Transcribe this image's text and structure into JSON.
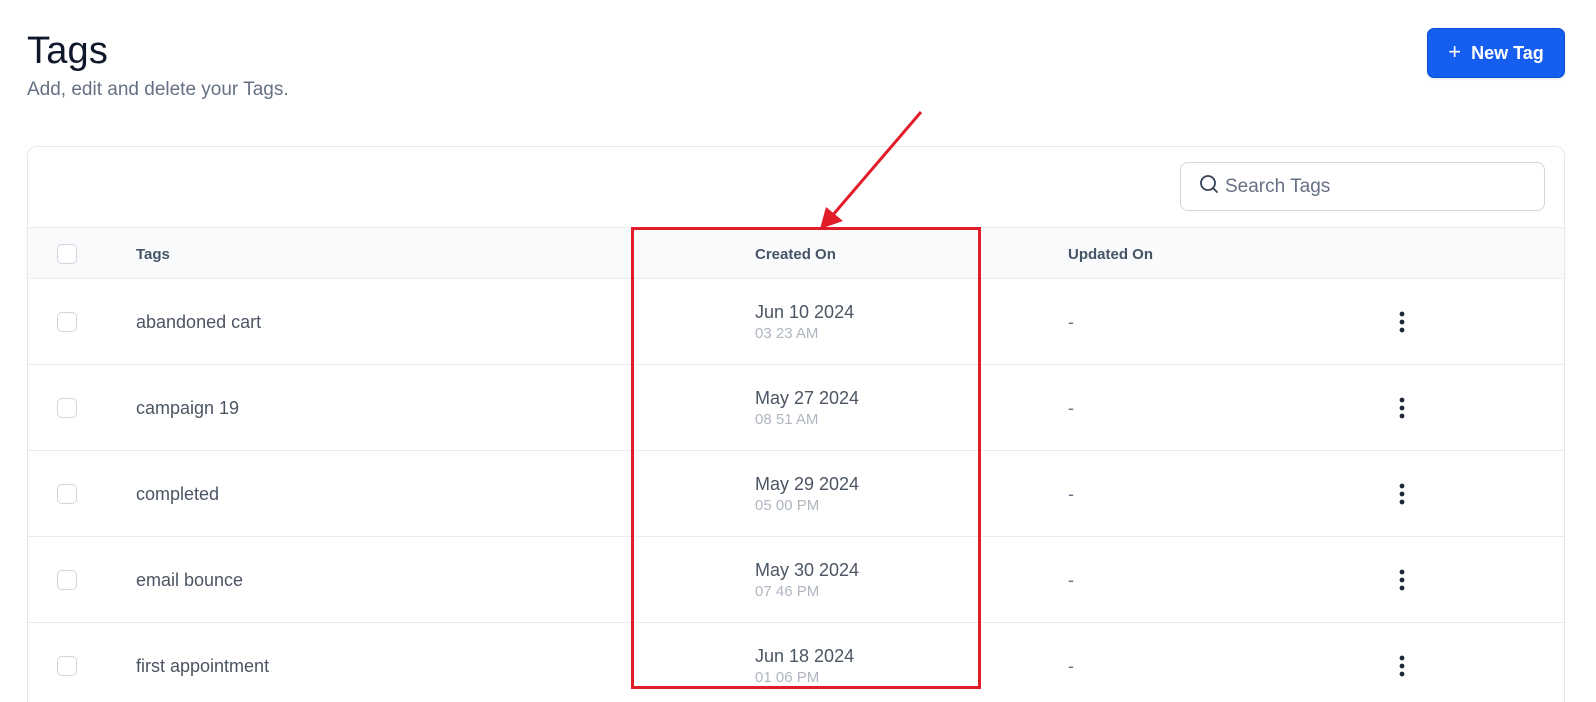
{
  "header": {
    "title": "Tags",
    "subtitle": "Add, edit and delete your Tags."
  },
  "new_tag_button": {
    "icon": "+",
    "label": "New Tag"
  },
  "search": {
    "placeholder": "Search Tags",
    "value": ""
  },
  "table": {
    "columns": {
      "tags": "Tags",
      "created_on": "Created On",
      "updated_on": "Updated On"
    },
    "rows": [
      {
        "name": "abandoned cart",
        "created_date": "Jun 10 2024",
        "created_time": "03 23 AM",
        "updated": "-"
      },
      {
        "name": "campaign 19",
        "created_date": "May 27 2024",
        "created_time": "08 51 AM",
        "updated": "-"
      },
      {
        "name": "completed",
        "created_date": "May 29 2024",
        "created_time": "05 00 PM",
        "updated": "-"
      },
      {
        "name": "email bounce",
        "created_date": "May 30 2024",
        "created_time": "07 46 PM",
        "updated": "-"
      },
      {
        "name": "first appointment",
        "created_date": "Jun 18 2024",
        "created_time": "01 06 PM",
        "updated": "-"
      }
    ]
  },
  "colors": {
    "primary": "#155eef",
    "annotation": "#e11d2a"
  }
}
